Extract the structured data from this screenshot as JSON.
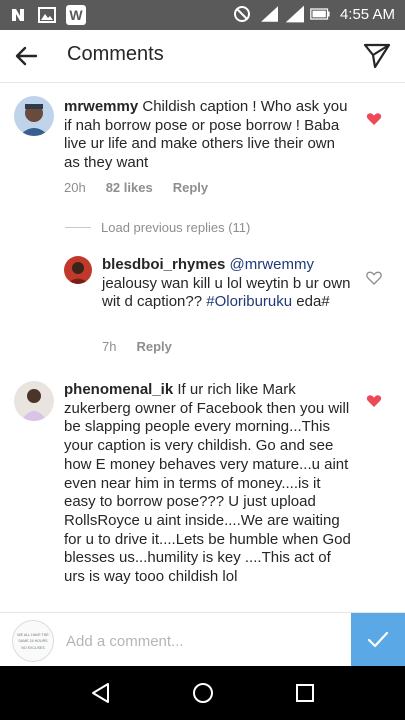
{
  "status_bar": {
    "time": "4:55 AM",
    "icons": [
      "n-app-icon",
      "gallery-icon",
      "w-app-icon",
      "do-not-disturb-icon",
      "signal-3g-icon",
      "signal-icon",
      "battery-icon"
    ],
    "w_letter": "W"
  },
  "header": {
    "title": "Comments",
    "back_icon": "arrow-left-icon",
    "send_icon": "paper-plane-icon"
  },
  "comments": [
    {
      "username": "mrwemmy",
      "text": " Childish caption ! Who ask you if nah borrow pose or pose borrow ! Baba live ur life and make others live their own as they want",
      "time": "20h",
      "likes": "82 likes",
      "reply_label": "Reply",
      "liked": true
    },
    {
      "load_previous": "Load previous replies (11)"
    },
    {
      "username": "blesdboi_rhymes",
      "mention": " @mrwemmy",
      "text": " jealousy wan kill u lol weytin b ur own wit d caption?? ",
      "hashtag": "#Oloriburuku",
      "text_after": " eda#",
      "time": "7h",
      "reply_label": "Reply",
      "liked": false
    },
    {
      "username": "phenomenal_ik",
      "text": " If ur rich like Mark zukerberg owner of Facebook then you will be slapping people every morning...This your caption is very childish. Go and see how E money behaves very mature...u aint even near him in terms of money....is it easy to borrow pose??? U just upload RollsRoyce u aint inside....We are waiting for u to drive it....Lets be humble when God blesses us...humility is key ....This act of urs is way tooo childish lol",
      "liked": true
    }
  ],
  "comment_input": {
    "placeholder": "Add a comment..."
  },
  "self_avatar_text": [
    "WE ALL HAVE THE",
    "SAME 24 HOURS",
    "NO EXCUSES"
  ],
  "colors": {
    "heart_red": "#ed4956",
    "post_blue": "#5aa9e6",
    "status_bar": "#5a5a5a",
    "nav_bar": "#000000",
    "mention_blue": "#1f3a78"
  },
  "nav": {
    "icons": [
      "back-triangle-icon",
      "home-circle-icon",
      "recents-square-icon"
    ]
  }
}
